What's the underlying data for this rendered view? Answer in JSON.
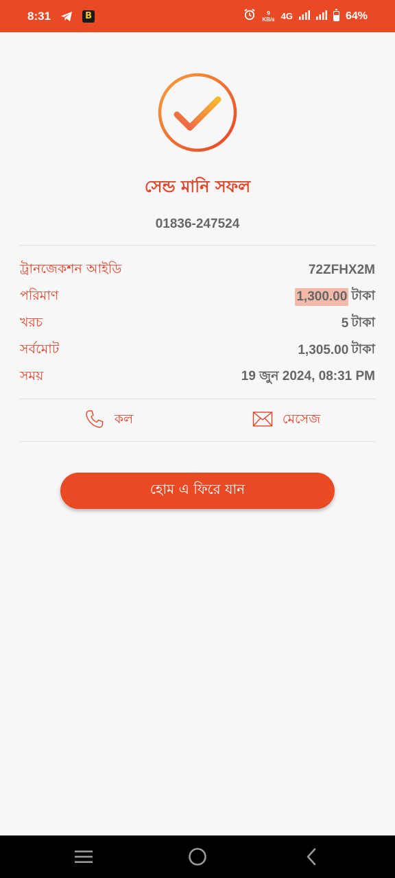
{
  "status_bar": {
    "time": "8:31",
    "speed_value": "9",
    "speed_unit": "KB/s",
    "network": "4G",
    "battery": "64%",
    "icons": [
      "telegram-icon",
      "b-app-icon",
      "alarm-icon",
      "signal-icon",
      "signal-icon",
      "battery-icon"
    ]
  },
  "result": {
    "icon": "check-circle-icon",
    "title": "সেন্ড মানি সফল",
    "phone": "01836-247524"
  },
  "details": [
    {
      "label": "ট্রানজেকশন আইডি",
      "value": "72ZFHX2M",
      "unit": ""
    },
    {
      "label": "পরিমাণ",
      "value": "1,300.00",
      "unit": "টাকা"
    },
    {
      "label": "খরচ",
      "value": "5",
      "unit": "টাকা"
    },
    {
      "label": "সর্বমোট",
      "value": "1,305.00",
      "unit": "টাকা"
    },
    {
      "label": "সময়",
      "value": "19 জুন 2024, 08:31 PM",
      "unit": ""
    }
  ],
  "actions": {
    "call_label": "কল",
    "message_label": "মেসেজ"
  },
  "home_button": "হোম এ ফিরে যান",
  "colors": {
    "accent": "#ea4a23",
    "title_red": "#e0462a",
    "highlight": "#f4b9a9"
  },
  "nav": [
    "menu-icon",
    "home-icon",
    "back-icon"
  ]
}
